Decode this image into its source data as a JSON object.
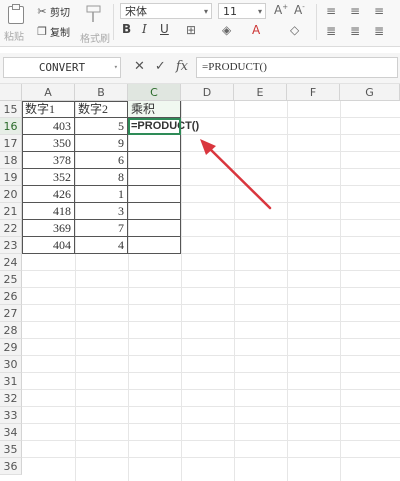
{
  "ribbon": {
    "paste_label": "粘贴",
    "cut_label": "剪切",
    "copy_label": "复制",
    "format_painter_label": "格式刷",
    "font_name": "宋体",
    "font_size": "11",
    "bold": "B",
    "italic": "I",
    "underline": "U"
  },
  "formula_bar": {
    "name_box": "CONVERT",
    "cancel": "✕",
    "enter": "✓",
    "fx": "fx",
    "formula": "=PRODUCT()"
  },
  "sheet": {
    "columns": [
      "A",
      "B",
      "C",
      "D",
      "E",
      "F",
      "G"
    ],
    "row_numbers": [
      "15",
      "16",
      "17",
      "18",
      "19",
      "20",
      "21",
      "22",
      "23",
      "24",
      "25",
      "26",
      "27",
      "28",
      "29",
      "30",
      "31",
      "32",
      "33",
      "34",
      "35",
      "36"
    ],
    "header_row": [
      "数字1",
      "数字2",
      "乘积"
    ],
    "rows": [
      {
        "a": "403",
        "b": "5"
      },
      {
        "a": "350",
        "b": "9"
      },
      {
        "a": "378",
        "b": "6"
      },
      {
        "a": "352",
        "b": "8"
      },
      {
        "a": "426",
        "b": "1"
      },
      {
        "a": "418",
        "b": "3"
      },
      {
        "a": "369",
        "b": "7"
      },
      {
        "a": "404",
        "b": "4"
      }
    ],
    "active_cell_text": "=PRODUCT()"
  },
  "colors": {
    "selection": "#2e8b57",
    "arrow": "#d9363e"
  }
}
